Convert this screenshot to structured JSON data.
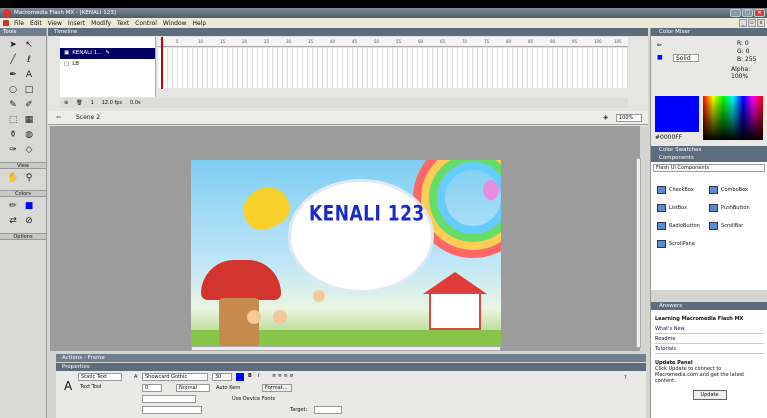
{
  "window": {
    "title": "Macromedia Flash MX - [KENALI 123]"
  },
  "menu": [
    "File",
    "Edit",
    "View",
    "Insert",
    "Modify",
    "Text",
    "Control",
    "Window",
    "Help"
  ],
  "tools": {
    "header": "Tools",
    "view_label": "View",
    "colors_label": "Colors",
    "options_label": "Options"
  },
  "timeline": {
    "header": "Timeline",
    "ruler": [
      "1",
      "5",
      "10",
      "15",
      "20",
      "25",
      "30",
      "35",
      "40",
      "45",
      "50",
      "55",
      "60",
      "65",
      "70",
      "75",
      "80",
      "85",
      "90",
      "95",
      "100",
      "105"
    ],
    "layers": [
      {
        "name": "KENALI 1..."
      },
      {
        "name": "LB"
      }
    ],
    "status": [
      "1",
      "12.0 fps",
      "0.0s"
    ]
  },
  "scene": {
    "label": "Scene 2",
    "zoom": "100%"
  },
  "stage": {
    "title_text": "KENALI 123"
  },
  "actions": {
    "header": "Actions - Frame"
  },
  "properties": {
    "header": "Properties",
    "text_type": "Static Text",
    "tool_label": "Text Tool",
    "font": "Showcard Gothic",
    "size": "30",
    "letter_spacing": "0",
    "kerning": "Normal",
    "auto_kern": "Auto Kern",
    "format_btn": "Format...",
    "device_fonts": "Use Device Fonts",
    "target_label": "Target:"
  },
  "right": {
    "color_mixer": "Color Mixer",
    "r": "R: 0",
    "g": "G: 0",
    "b": "B: 255",
    "fill_type": "Solid",
    "alpha": "Alpha: 100%",
    "hex": "#0000FF",
    "swatches": "Color Swatches",
    "components": "Components",
    "comp_set": "Flash UI Components",
    "comp_items": [
      "CheckBox",
      "ComboBox",
      "ListBox",
      "PushButton",
      "RadioButton",
      "ScrollBar",
      "ScrollPane"
    ],
    "answers": "Answers",
    "answers_title": "Learning Macromedia Flash MX",
    "answers_links": [
      "What's New",
      "Readme",
      "Tutorials"
    ],
    "update_title": "Update Panel",
    "update_text": "Click Update to connect to Macromedia.com and get the latest content.",
    "update_btn": "Update"
  },
  "colors": {
    "titlebar": "#5d6d7d",
    "stage_text": "#1a2ac8",
    "fill": "#0000ff"
  }
}
